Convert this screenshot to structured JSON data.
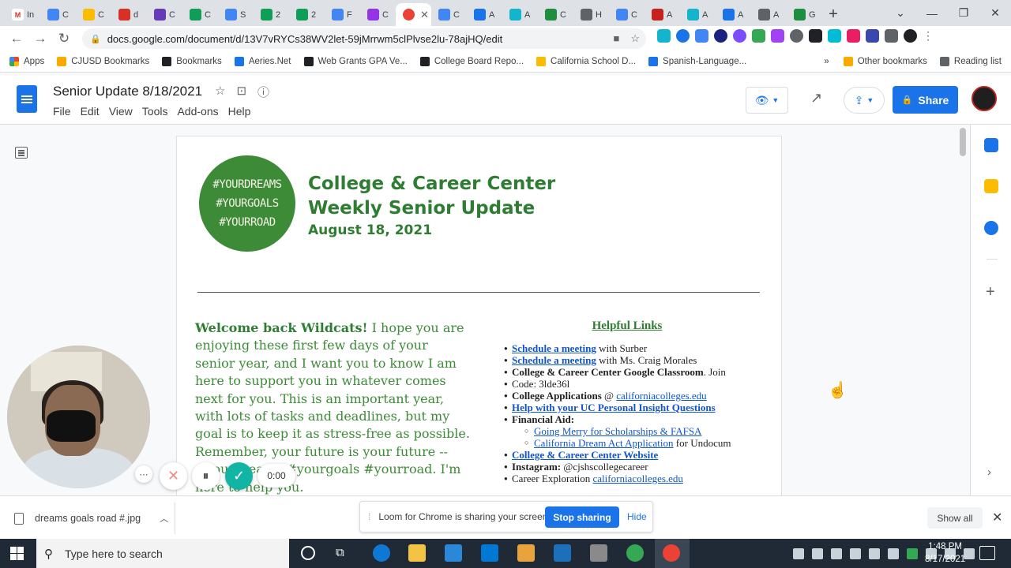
{
  "browser": {
    "tabs": [
      {
        "label": "In",
        "color": "#ffffff",
        "glyph": "M"
      },
      {
        "label": "C",
        "color": "#4285f4",
        "glyph": ""
      },
      {
        "label": "C",
        "color": "#fbbc04",
        "glyph": ""
      },
      {
        "label": "d",
        "color": "#d93025",
        "glyph": ""
      },
      {
        "label": "C",
        "color": "#673ab7",
        "glyph": ""
      },
      {
        "label": "C",
        "color": "#0f9d58",
        "glyph": ""
      },
      {
        "label": "S",
        "color": "#4285f4",
        "glyph": ""
      },
      {
        "label": "2",
        "color": "#0f9d58",
        "glyph": ""
      },
      {
        "label": "2",
        "color": "#0f9d58",
        "glyph": ""
      },
      {
        "label": "F",
        "color": "#4285f4",
        "glyph": ""
      },
      {
        "label": "C",
        "color": "#9334e6",
        "glyph": ""
      },
      {
        "label": "",
        "color": "#ea4335",
        "glyph": "",
        "active": true
      },
      {
        "label": "C",
        "color": "#4285f4",
        "glyph": ""
      },
      {
        "label": "A",
        "color": "#1a73e8",
        "glyph": ""
      },
      {
        "label": "A",
        "color": "#12b5cb",
        "glyph": ""
      },
      {
        "label": "C",
        "color": "#1e8e3e",
        "glyph": ""
      },
      {
        "label": "H",
        "color": "#5f6368",
        "glyph": ""
      },
      {
        "label": "C",
        "color": "#4285f4",
        "glyph": ""
      },
      {
        "label": "A",
        "color": "#c5221f",
        "glyph": ""
      },
      {
        "label": "A",
        "color": "#12b5cb",
        "glyph": ""
      },
      {
        "label": "A",
        "color": "#1a73e8",
        "glyph": ""
      },
      {
        "label": "A",
        "color": "#5f6368",
        "glyph": ""
      },
      {
        "label": "G",
        "color": "#1e8e3e",
        "glyph": ""
      }
    ],
    "url": "docs.google.com/document/d/13V7vRYCs38WV2let-59jMrrwm5clPlvse2lu-78ajHQ/edit",
    "bookmarks": [
      {
        "label": "Apps",
        "color": "#ea4335"
      },
      {
        "label": "CJUSD Bookmarks",
        "color": "#f9ab00"
      },
      {
        "label": "Bookmarks",
        "color": "#202124"
      },
      {
        "label": "Aeries.Net",
        "color": "#1a73e8"
      },
      {
        "label": "Web Grants GPA Ve...",
        "color": "#202124"
      },
      {
        "label": "College Board Repo...",
        "color": "#202124"
      },
      {
        "label": "California School D...",
        "color": "#fbbc04"
      },
      {
        "label": "Spanish-Language...",
        "color": "#1a73e8"
      }
    ],
    "bookmarks_more": "»",
    "other_bookmarks": "Other bookmarks",
    "reading_list": "Reading list"
  },
  "docs": {
    "title": "Senior Update 8/18/2021",
    "menu": [
      "File",
      "Edit",
      "View",
      "Tools",
      "Add-ons",
      "Help"
    ],
    "share_label": "Share"
  },
  "document": {
    "logo_lines": [
      "#YOURDREAMS",
      "#YOURGOALS",
      "#YOURROAD"
    ],
    "heading_line1": "College & Career Center",
    "heading_line2": "Weekly Senior Update",
    "date": "August 18, 2021",
    "welcome_bold": "Welcome back Wildcats!",
    "welcome_text": " I hope you are enjoying these first few days of your senior year, and I want you to know I am here to support you in whatever comes next for you. This is an important year, with lots of tasks and deadlines, but my goal is to keep it as stress-free as possible. Remember, your future is your future -- #yourdreams #yourgoals #yourroad. I'm here to help you.",
    "links_title": "Helpful Links",
    "links": {
      "l1_link": "Schedule a meeting",
      "l1_text": " with Surber",
      "l2_link": "Schedule a meeting",
      "l2_text": " with Ms. Craig Morales",
      "l3_bold": "College & Career Center Google Classroom",
      "l3_text": ". Join",
      "l3_cont": "Code: 3lde36l",
      "l4_bold": "College Applications",
      "l4_text": " @ ",
      "l4_link": "californiacolleges.edu",
      "l5_link": "Help with your UC Personal Insight Questions",
      "l6_bold": "Financial Aid:",
      "l6a_link": "Going Merry for Scholarships & FAFSA",
      "l6b_link": "California Dream Act Application",
      "l6b_text": " for Undocum",
      "l7_link": "College & Career Center Website",
      "l8_bold": "Instagram:",
      "l8_text": " @cjshscollegecareer",
      "l9_text": "Career Exploration ",
      "l9_link": "californiacolleges.edu"
    }
  },
  "loom": {
    "timer": "0:00",
    "sharing_text": "Loom for Chrome is sharing your screen.",
    "stop_label": "Stop sharing",
    "hide_label": "Hide"
  },
  "downloads": {
    "filename": "dreams goals road #.jpg",
    "show_all": "Show all"
  },
  "taskbar": {
    "search_placeholder": "Type here to search",
    "time": "1:48 PM",
    "date": "8/17/2021"
  }
}
